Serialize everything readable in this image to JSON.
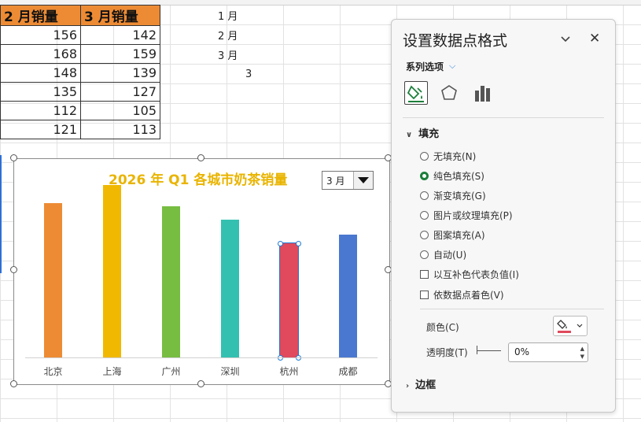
{
  "sheet": {
    "headers": [
      "2 月销量",
      "3 月销量"
    ],
    "rows": [
      [
        "156",
        "142"
      ],
      [
        "168",
        "159"
      ],
      [
        "148",
        "139"
      ],
      [
        "135",
        "127"
      ],
      [
        "112",
        "105"
      ],
      [
        "121",
        "113"
      ]
    ],
    "month_list": [
      "1 月",
      "2 月",
      "3 月"
    ],
    "selected_index": "3"
  },
  "chart_data": {
    "type": "bar",
    "title": "2026 年 Q1 各城市奶茶销量",
    "categories": [
      "北京",
      "上海",
      "广州",
      "深圳",
      "杭州",
      "成都"
    ],
    "values": [
      142,
      159,
      139,
      127,
      105,
      113
    ],
    "bar_colors": [
      "#ed8b34",
      "#f0b800",
      "#77bd41",
      "#33c0b0",
      "#e04a5c",
      "#4a78d0"
    ],
    "selected_point": "杭州",
    "ylim": [
      0,
      200
    ],
    "grid": false,
    "legend": "none"
  },
  "dropdown": {
    "value": "3 月"
  },
  "pane": {
    "title": "设置数据点格式",
    "series_options": "系列选项",
    "tabs": [
      "fill-line-icon",
      "effects-pentagon-icon",
      "series-options-bars-icon"
    ],
    "fill_section": "填充",
    "fill_options": [
      "无填充(N)",
      "纯色填充(S)",
      "渐变填充(G)",
      "图片或纹理填充(P)",
      "图案填充(A)",
      "自动(U)"
    ],
    "fill_selected": "纯色填充(S)",
    "checkboxes": [
      "以互补色代表负值(I)",
      "依数据点着色(V)"
    ],
    "color_label": "颜色(C)",
    "color_value": "#e04a5c",
    "transparency_label": "透明度(T)",
    "transparency_value": "0%",
    "border_section": "边框"
  }
}
